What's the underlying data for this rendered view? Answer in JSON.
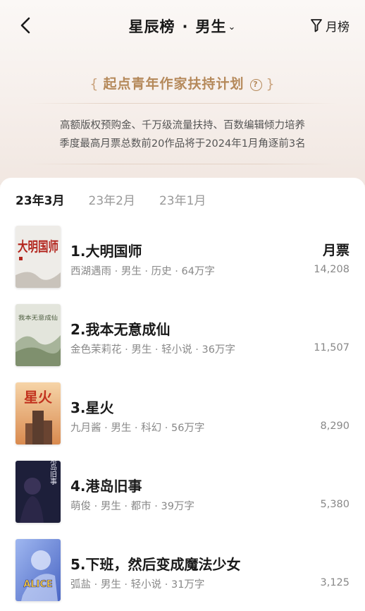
{
  "nav": {
    "title": "星辰榜",
    "separator": "·",
    "category": "男生",
    "filter_label": "月榜",
    "icons": {
      "back": "chevron-left-icon",
      "category_dropdown": "chevron-down-icon",
      "filter": "filter-funnel-icon"
    }
  },
  "banner": {
    "title": "起点青年作家扶持计划",
    "brace_left": "{",
    "brace_right": "}",
    "help_icon": "?",
    "line1": "高额版权预购金、千万级流量扶持、百数编辑倾力培养",
    "line2": "季度最高月票总数前20作品将于2024年1月角逐前3名"
  },
  "tabs": [
    {
      "label": "23年3月",
      "active": true
    },
    {
      "label": "23年2月",
      "active": false
    },
    {
      "label": "23年1月",
      "active": false
    }
  ],
  "votes_header": "月票",
  "books": [
    {
      "title": "1.大明国师",
      "meta": "西湖遇雨 · 男生 · 历史 · 64万字",
      "votes": "14,208"
    },
    {
      "title": "2.我本无意成仙",
      "meta": "金色茉莉花 · 男生 · 轻小说 · 36万字",
      "votes": "11,507"
    },
    {
      "title": "3.星火",
      "meta": "九月酱 · 男生 · 科幻 · 56万字",
      "votes": "8,290"
    },
    {
      "title": "4.港岛旧事",
      "meta": "萌俊 · 男生 · 都市 · 39万字",
      "votes": "5,380"
    },
    {
      "title": "5.下班，然后变成魔法少女",
      "meta": "弧盐 · 男生 · 轻小说 · 31万字",
      "votes": "3,125"
    }
  ],
  "covers": [
    {
      "text": "大明国师",
      "bg": "#eeece8",
      "fg": "#b3261e"
    },
    {
      "text": "我本无意成仙",
      "bg": "#d8dccf",
      "fg": "#4a5a3c"
    },
    {
      "text": "星火",
      "bg": "#f0c08c",
      "fg": "#c2331f"
    },
    {
      "text": "港岛旧事",
      "bg": "#1d1f3a",
      "fg": "#e8e8f5"
    },
    {
      "text": "ALICE",
      "bg": "#6f8fd8",
      "fg": "#ffd23a"
    }
  ],
  "colors": {
    "accent": "#b5895a",
    "tab_underline": "#e74c4c",
    "background": "#f7f2ef"
  }
}
